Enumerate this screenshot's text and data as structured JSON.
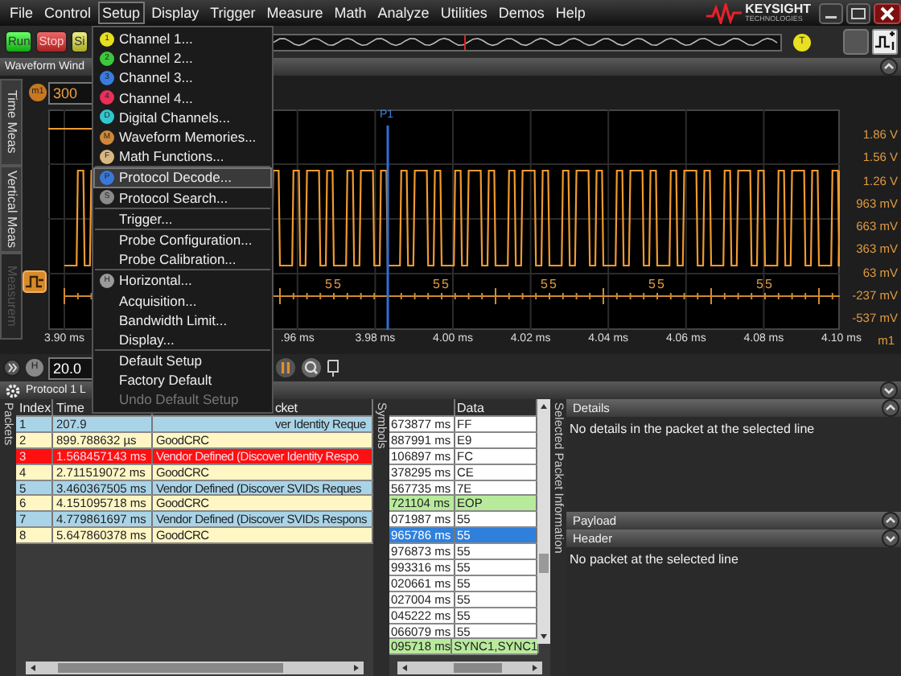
{
  "menu_bar": {
    "items": [
      {
        "label": "File",
        "selected": false
      },
      {
        "label": "Control",
        "selected": false
      },
      {
        "label": "Setup",
        "selected": true
      },
      {
        "label": "Display",
        "selected": false
      },
      {
        "label": "Trigger",
        "selected": false
      },
      {
        "label": "Measure",
        "selected": false
      },
      {
        "label": "Math",
        "selected": false
      },
      {
        "label": "Analyze",
        "selected": false
      },
      {
        "label": "Utilities",
        "selected": false
      },
      {
        "label": "Demos",
        "selected": false
      },
      {
        "label": "Help",
        "selected": false
      }
    ]
  },
  "logo": {
    "name": "KEYSIGHT",
    "subtitle": "TECHNOLOGIES"
  },
  "toolbar": {
    "buttons": [
      {
        "label": "Run",
        "kind": "run"
      },
      {
        "label": "Stop",
        "kind": "stop"
      },
      {
        "label": "Si",
        "kind": "single"
      }
    ],
    "trigger_button": "T"
  },
  "waveform_window": {
    "title": "Waveform Wind",
    "side_tabs": [
      {
        "label": "Time Meas",
        "disabled": false
      },
      {
        "label": "Vertical Meas",
        "disabled": false
      },
      {
        "label": "Measurem",
        "disabled": true
      }
    ],
    "channel": {
      "badge": "m1",
      "scale": "300"
    },
    "marker": "P1",
    "bus_labels": [
      "55",
      "55",
      "55",
      "55",
      "55"
    ],
    "y_labels": [
      "1.86 V",
      "1.56 V",
      "1.26 V",
      "963 mV",
      "663 mV",
      "363 mV",
      "63 mV",
      "-237 mV",
      "-537 mV"
    ],
    "x_labels": [
      "3.90 ms",
      ".96 ms",
      "3.98 ms",
      "4.00 ms",
      "4.02 ms",
      "4.04 ms",
      "4.06 ms",
      "4.08 ms",
      "4.10 ms"
    ],
    "x_badge": "m1",
    "horizontal": {
      "badge": "H",
      "scale": "20.0"
    }
  },
  "setup_menu": {
    "items": [
      {
        "label": "Channel 1...",
        "badge": "1",
        "color": "#e6e020",
        "separator_before": false,
        "selected": false,
        "disabled": false
      },
      {
        "label": "Channel 2...",
        "badge": "2",
        "color": "#3cc83c",
        "separator_before": false,
        "selected": false,
        "disabled": false
      },
      {
        "label": "Channel 3...",
        "badge": "3",
        "color": "#3a7be0",
        "separator_before": false,
        "selected": false,
        "disabled": false
      },
      {
        "label": "Channel 4...",
        "badge": "4",
        "color": "#e8305a",
        "separator_before": false,
        "selected": false,
        "disabled": false
      },
      {
        "label": "Digital Channels...",
        "badge": "D",
        "color": "#30c8d0",
        "separator_before": false,
        "selected": false,
        "disabled": false
      },
      {
        "label": "Waveform Memories...",
        "badge": "M",
        "color": "#d08838",
        "separator_before": false,
        "selected": false,
        "disabled": false
      },
      {
        "label": "Math Functions...",
        "badge": "F",
        "color": "#d8b880",
        "separator_before": false,
        "selected": false,
        "disabled": false
      },
      {
        "label": "Protocol Decode...",
        "badge": "P",
        "color": "#3a78d8",
        "separator_before": true,
        "selected": true,
        "disabled": false
      },
      {
        "label": "Protocol Search...",
        "badge": "S",
        "color": "#8a8a8a",
        "separator_before": false,
        "selected": false,
        "disabled": false
      },
      {
        "label": "Trigger...",
        "separator_before": true,
        "selected": false,
        "disabled": false
      },
      {
        "label": "Probe Configuration...",
        "separator_before": true,
        "selected": false,
        "disabled": false
      },
      {
        "label": "Probe Calibration...",
        "separator_before": false,
        "selected": false,
        "disabled": false
      },
      {
        "label": "Horizontal...",
        "badge": "H",
        "color": "#9a9a9a",
        "separator_before": true,
        "selected": false,
        "disabled": false
      },
      {
        "label": "Acquisition...",
        "separator_before": false,
        "selected": false,
        "disabled": false
      },
      {
        "label": "Bandwidth Limit...",
        "separator_before": false,
        "selected": false,
        "disabled": false
      },
      {
        "label": "Display...",
        "separator_before": false,
        "selected": false,
        "disabled": false
      },
      {
        "label": "Default Setup",
        "separator_before": true,
        "selected": false,
        "disabled": false
      },
      {
        "label": "Factory Default",
        "separator_before": false,
        "selected": false,
        "disabled": false
      },
      {
        "label": "Undo Default Setup",
        "separator_before": false,
        "selected": false,
        "disabled": true
      }
    ]
  },
  "protocol_panel": {
    "title": "Protocol 1 L",
    "packets": {
      "label": "Packets",
      "columns": [
        "Index",
        "Time",
        "cket"
      ],
      "rows": [
        {
          "index": "1",
          "time": "207.9",
          "packet": "ver Identity Reque",
          "color": "#a9d4e8"
        },
        {
          "index": "2",
          "time": "899.788632 µs",
          "packet": "GoodCRC",
          "color": "#fff6c4"
        },
        {
          "index": "3",
          "time": "1.568457143 ms",
          "packet": "Vendor Defined (Discover Identity Respo",
          "color": "#ff1010"
        },
        {
          "index": "4",
          "time": "2.711519072 ms",
          "packet": "GoodCRC",
          "color": "#fff6c4"
        },
        {
          "index": "5",
          "time": "3.460367505 ms",
          "packet": "Vendor Defined (Discover SVIDs Reques",
          "color": "#a9d4e8"
        },
        {
          "index": "6",
          "time": "4.151095718 ms",
          "packet": "GoodCRC",
          "color": "#fff6c4"
        },
        {
          "index": "7",
          "time": "4.779861697 ms",
          "packet": "Vendor Defined (Discover SVIDs Respons",
          "color": "#a9d4e8"
        },
        {
          "index": "8",
          "time": "5.647860378 ms",
          "packet": "GoodCRC",
          "color": "#fff6c4"
        }
      ]
    },
    "symbols": {
      "label": "Symbols",
      "columns": [
        "Data"
      ],
      "rows": [
        {
          "time": "673877 ms",
          "data": "FF",
          "color": "#ffffff",
          "selected": false
        },
        {
          "time": "887991 ms",
          "data": "E9",
          "color": "#ffffff",
          "selected": false
        },
        {
          "time": "106897 ms",
          "data": "FC",
          "color": "#ffffff",
          "selected": false
        },
        {
          "time": "378295 ms",
          "data": "CE",
          "color": "#ffffff",
          "selected": false
        },
        {
          "time": "567735 ms",
          "data": "7E",
          "color": "#ffffff",
          "selected": false
        },
        {
          "time": "721104 ms",
          "data": "EOP",
          "color": "#b8ea9c",
          "selected": false
        },
        {
          "time": "071987 ms",
          "data": "55",
          "color": "#ffffff",
          "selected": false
        },
        {
          "time": "965786 ms",
          "data": "55",
          "selected": true
        },
        {
          "time": "976873 ms",
          "data": "55",
          "color": "#ffffff",
          "selected": false
        },
        {
          "time": "993316 ms",
          "data": "55",
          "color": "#ffffff",
          "selected": false
        },
        {
          "time": "020661 ms",
          "data": "55",
          "color": "#ffffff",
          "selected": false
        },
        {
          "time": "027004 ms",
          "data": "55",
          "color": "#ffffff",
          "selected": false
        },
        {
          "time": "045222 ms",
          "data": "55",
          "color": "#ffffff",
          "selected": false
        },
        {
          "time": "066079 ms",
          "data": "55",
          "color": "#ffffff",
          "selected": false
        },
        {
          "time": "095718 ms",
          "data": "SYNC1,SYNC1",
          "color": "#b8ea9c",
          "selected": false
        }
      ]
    },
    "info": {
      "label": "Selected Packet Information",
      "details_title": "Details",
      "details_message": "No details in the packet at the selected line",
      "payload_title": "Payload",
      "header_title": "Header",
      "header_message": "No packet at the selected line"
    }
  }
}
